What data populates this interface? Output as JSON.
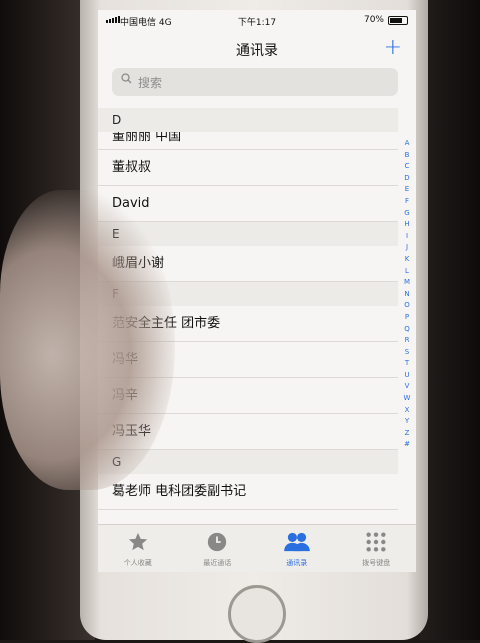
{
  "status_bar": {
    "carrier": "中国电信  4G",
    "time": "下午1:17",
    "battery": "70%"
  },
  "nav": {
    "title": "通讯录",
    "add_label": "+"
  },
  "search": {
    "placeholder": "搜索"
  },
  "sections": [
    {
      "letter": "D",
      "rows": [
        "董丽丽 中国",
        "董叔叔",
        "David"
      ]
    },
    {
      "letter": "E",
      "rows": [
        "峨眉小谢"
      ]
    },
    {
      "letter": "F",
      "rows": [
        "范安全主任 团市委",
        "冯华",
        "冯辛",
        "冯玉华"
      ]
    },
    {
      "letter": "G",
      "rows": [
        "葛老师 电科团委副书记"
      ]
    }
  ],
  "index_letters": [
    "A",
    "B",
    "C",
    "D",
    "E",
    "F",
    "G",
    "H",
    "I",
    "J",
    "K",
    "L",
    "M",
    "N",
    "O",
    "P",
    "Q",
    "R",
    "S",
    "T",
    "U",
    "V",
    "W",
    "X",
    "Y",
    "Z",
    "#"
  ],
  "tabs": [
    {
      "label": "个人收藏",
      "icon": "star-icon"
    },
    {
      "label": "最近通话",
      "icon": "clock-icon"
    },
    {
      "label": "通讯录",
      "icon": "contacts-icon"
    },
    {
      "label": "拨号键盘",
      "icon": "keypad-icon"
    }
  ],
  "colors": {
    "accent": "#2a6fe0"
  }
}
